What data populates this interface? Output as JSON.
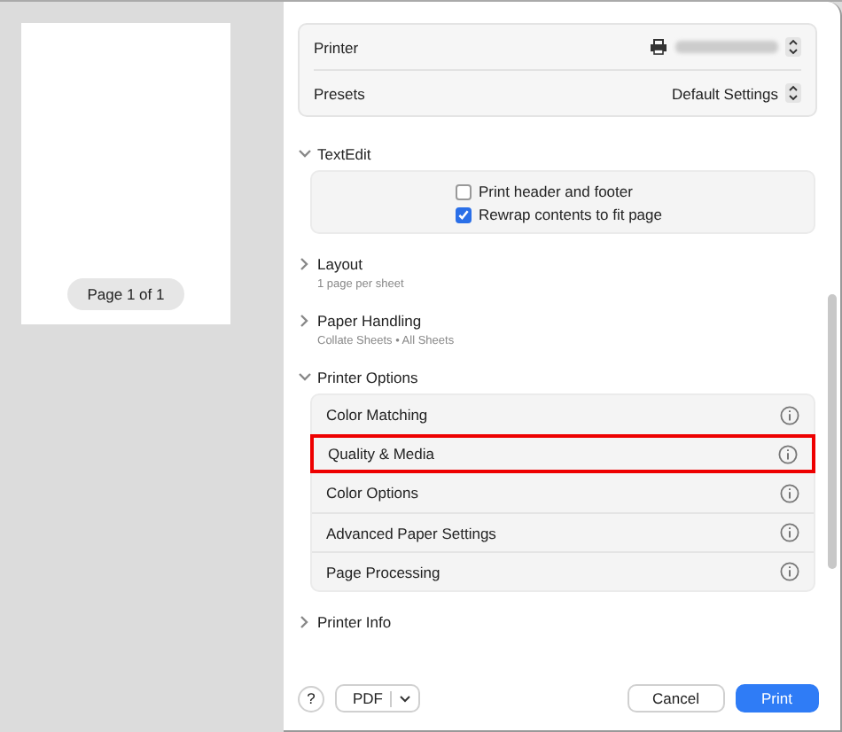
{
  "preview": {
    "page_label": "Page 1 of 1"
  },
  "header": {
    "printer": {
      "label": "Printer"
    },
    "presets": {
      "label": "Presets",
      "value": "Default Settings"
    }
  },
  "textedit": {
    "title": "TextEdit",
    "expanded": true,
    "options": [
      {
        "label": "Print header and footer",
        "checked": false
      },
      {
        "label": "Rewrap contents to fit page",
        "checked": true
      }
    ]
  },
  "sections": [
    {
      "title": "Layout",
      "subtitle": "1 page per sheet",
      "expanded": false
    },
    {
      "title": "Paper Handling",
      "subtitle": "Collate Sheets • All Sheets",
      "expanded": false
    }
  ],
  "printer_options": {
    "title": "Printer Options",
    "expanded": true,
    "items": [
      {
        "label": "Color Matching",
        "selected": false
      },
      {
        "label": "Quality & Media",
        "selected": true
      },
      {
        "label": "Color Options",
        "selected": false
      },
      {
        "label": "Advanced Paper Settings",
        "selected": false
      },
      {
        "label": "Page Processing",
        "selected": false
      }
    ]
  },
  "printer_info": {
    "title": "Printer Info",
    "expanded": false
  },
  "footer": {
    "help": "?",
    "pdf": "PDF",
    "cancel": "Cancel",
    "print": "Print"
  }
}
